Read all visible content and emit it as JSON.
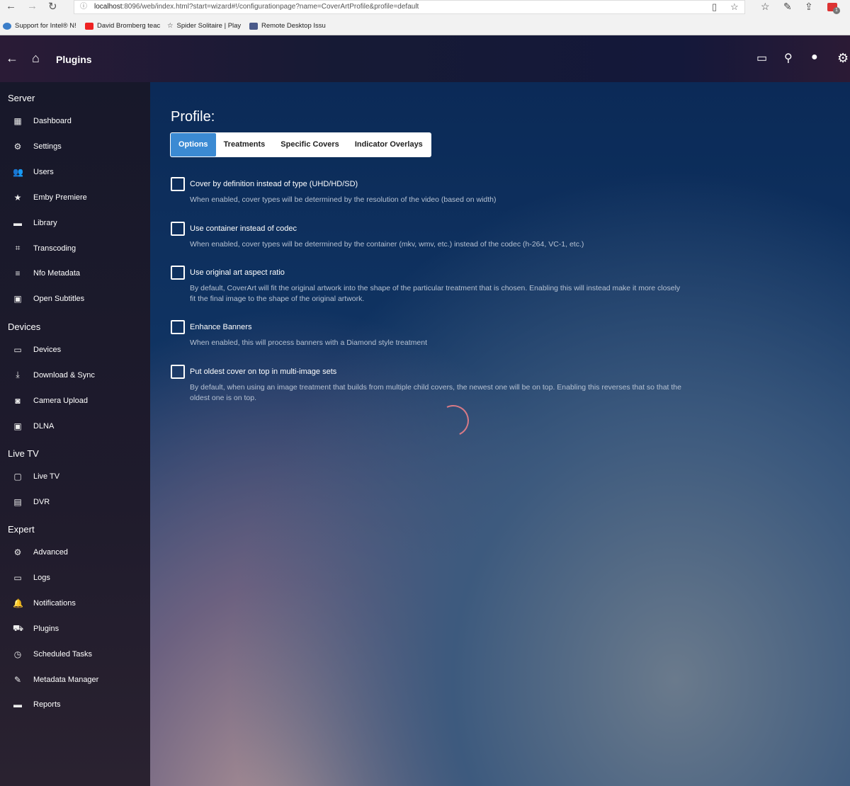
{
  "browser": {
    "url_host": "localhost",
    "url_rest": ":8096/web/index.html?start=wizard#!/configurationpage?name=CoverArtProfile&profile=default",
    "bookmarks": [
      "Support for Intel® N!",
      "David Bromberg teac",
      "Spider Solitaire | Play",
      "Remote Desktop Issu"
    ],
    "ext_badge": "1"
  },
  "header": {
    "title": "Plugins"
  },
  "sidebar": {
    "sections": [
      {
        "title": "Server",
        "items": [
          "Dashboard",
          "Settings",
          "Users",
          "Emby Premiere",
          "Library",
          "Transcoding",
          "Nfo Metadata",
          "Open Subtitles"
        ]
      },
      {
        "title": "Devices",
        "items": [
          "Devices",
          "Download & Sync",
          "Camera Upload",
          "DLNA"
        ]
      },
      {
        "title": "Live TV",
        "items": [
          "Live TV",
          "DVR"
        ]
      },
      {
        "title": "Expert",
        "items": [
          "Advanced",
          "Logs",
          "Notifications",
          "Plugins",
          "Scheduled Tasks",
          "Metadata Manager",
          "Reports"
        ]
      }
    ]
  },
  "main": {
    "title": "Profile:",
    "tabs": [
      "Options",
      "Treatments",
      "Specific Covers",
      "Indicator Overlays"
    ],
    "options": [
      {
        "label": "Cover by definition instead of type (UHD/HD/SD)",
        "desc": "When enabled, cover types will be determined by the resolution of the video (based on width)",
        "checked": false
      },
      {
        "label": "Use container instead of codec",
        "desc": "When enabled, cover types will be determined by the container (mkv, wmv, etc.) instead of the codec (h-264, VC-1, etc.)",
        "checked": false
      },
      {
        "label": "Use original art aspect ratio",
        "desc": "By default, CoverArt will fit the original artwork into the shape of the particular treatment that is chosen. Enabling this will instead make it more closely fit the final image to the shape of the original artwork.",
        "checked": false
      },
      {
        "label": "Enhance Banners",
        "desc": "When enabled, this will process banners with a Diamond style treatment",
        "checked": false
      },
      {
        "label": "Put oldest cover on top in multi-image sets",
        "desc": "By default, when using an image treatment that builds from multiple child covers, the newest one will be on top. Enabling this reverses that so that the oldest one is on top.",
        "checked": false
      }
    ]
  }
}
